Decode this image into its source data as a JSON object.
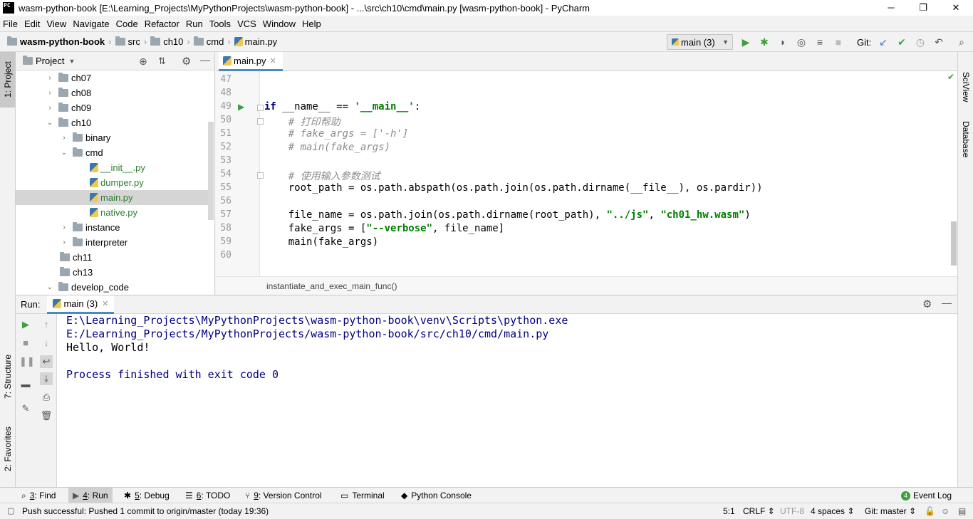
{
  "window": {
    "title": "wasm-python-book [E:\\Learning_Projects\\MyPythonProjects\\wasm-python-book] - ...\\src\\ch10\\cmd\\main.py [wasm-python-book] - PyCharm",
    "logo": "PC",
    "min": "─",
    "max": "❐",
    "close": "✕"
  },
  "menu": [
    "File",
    "Edit",
    "View",
    "Navigate",
    "Code",
    "Refactor",
    "Run",
    "Tools",
    "VCS",
    "Window",
    "Help"
  ],
  "nav": {
    "project": "wasm-python-book",
    "crumbs": [
      "src",
      "ch10",
      "cmd",
      "main.py"
    ],
    "run_config": "main (3)",
    "git_label": "Git:"
  },
  "left_strip": {
    "project_tab": "1: Project",
    "structure_tab": "7: Structure",
    "favorites_tab": "2: Favorites"
  },
  "right_strip": {
    "sciview_tab": "SciView",
    "database_tab": "Database"
  },
  "project_panel": {
    "title": "Project",
    "tree": [
      {
        "label": "ch07"
      },
      {
        "label": "ch08"
      },
      {
        "label": "ch09"
      },
      {
        "label": "ch10"
      },
      {
        "label": "binary"
      },
      {
        "label": "cmd"
      },
      {
        "label": "__init__.py"
      },
      {
        "label": "dumper.py"
      },
      {
        "label": "main.py"
      },
      {
        "label": "native.py"
      },
      {
        "label": "instance"
      },
      {
        "label": "interpreter"
      },
      {
        "label": "ch11"
      },
      {
        "label": "ch13"
      },
      {
        "label": "develop_code"
      }
    ]
  },
  "editor": {
    "tab": "main.py",
    "line_numbers": [
      "47",
      "48",
      "49",
      "50",
      "51",
      "52",
      "53",
      "54",
      "55",
      "56",
      "57",
      "58",
      "59",
      "60"
    ],
    "code": {
      "l49_kw": "if",
      "l49_a": " __name__ == ",
      "l49_str": "'__main__'",
      "l49_b": ":",
      "l50": "    # 打印帮助",
      "l51": "    # fake_args = ['-h']",
      "l52": "    # main(fake_args)",
      "l54": "    # 使用输入参数测试",
      "l55": "    root_path = os.path.abspath(os.path.join(os.path.dirname(__file__), os.pardir))",
      "l57_a": "    file_name = os.path.join(os.path.dirname(root_path), ",
      "l57_s1": "\"../js\"",
      "l57_b": ", ",
      "l57_s2": "\"ch01_hw.wasm\"",
      "l57_c": ")",
      "l58_a": "    fake_args = [",
      "l58_s": "\"--verbose\"",
      "l58_b": ", file_name]",
      "l59": "    main(fake_args)"
    },
    "breadcrumb": "instantiate_and_exec_main_func()"
  },
  "run_panel": {
    "label": "Run:",
    "tab": "main (3)",
    "output": [
      "E:\\Learning_Projects\\MyPythonProjects\\wasm-python-book\\venv\\Scripts\\python.exe",
      " E:/Learning_Projects/MyPythonProjects/wasm-python-book/src/ch10/cmd/main.py",
      "Hello, World!",
      "",
      "Process finished with exit code 0"
    ]
  },
  "bottom_tabs": [
    {
      "key": "3",
      "label": ": Find",
      "icon": "search-icon"
    },
    {
      "key": "4",
      "label": ": Run",
      "icon": "run-icon"
    },
    {
      "key": "5",
      "label": ": Debug",
      "icon": "debug-icon"
    },
    {
      "key": "6",
      "label": ": TODO",
      "icon": "todo-icon"
    },
    {
      "key": "9",
      "label": ": Version Control",
      "icon": "vcs-icon"
    },
    {
      "key": "",
      "label": "Terminal",
      "icon": "terminal-icon"
    },
    {
      "key": "",
      "label": "Python Console",
      "icon": "python-console-icon"
    }
  ],
  "event_log": {
    "count": "4",
    "label": "Event Log"
  },
  "status": {
    "message": "Push successful: Pushed 1 commit to origin/master (today 19:36)",
    "position": "5:1",
    "line_sep": "CRLF ⇕",
    "encoding": "UTF-8",
    "indent": "4 spaces ⇕",
    "branch": "Git: master ⇕"
  },
  "colors": {
    "accent": "#4a88c7",
    "run_green": "#3d9f3d",
    "console_blue": "#000080"
  }
}
